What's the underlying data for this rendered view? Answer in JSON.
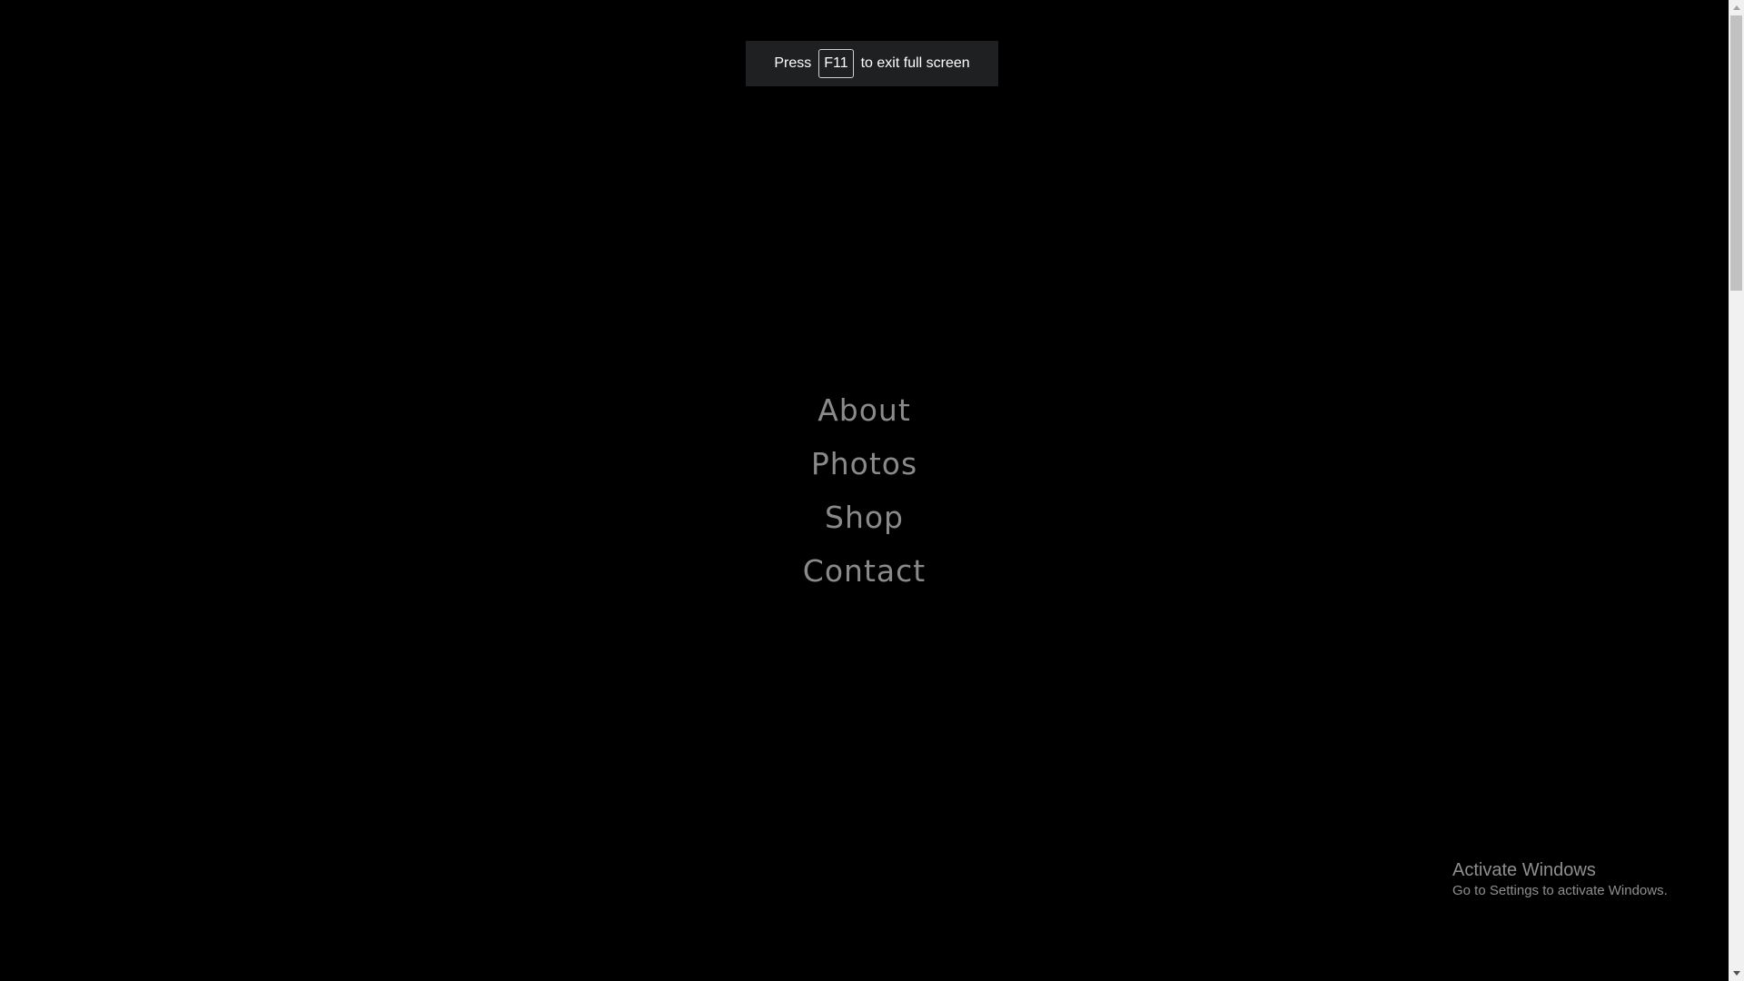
{
  "fullscreen_toast": {
    "prefix": "Press",
    "key": "F11",
    "suffix": "to exit full screen"
  },
  "menu": {
    "items": [
      {
        "label": "About"
      },
      {
        "label": "Photos"
      },
      {
        "label": "Shop"
      },
      {
        "label": "Contact"
      }
    ]
  },
  "watermark": {
    "title": "Activate Windows",
    "subtitle": "Go to Settings to activate Windows."
  },
  "colors": {
    "background": "#000000",
    "menu_text": "#8a8a8a",
    "toast_bg": "#1f2022"
  }
}
